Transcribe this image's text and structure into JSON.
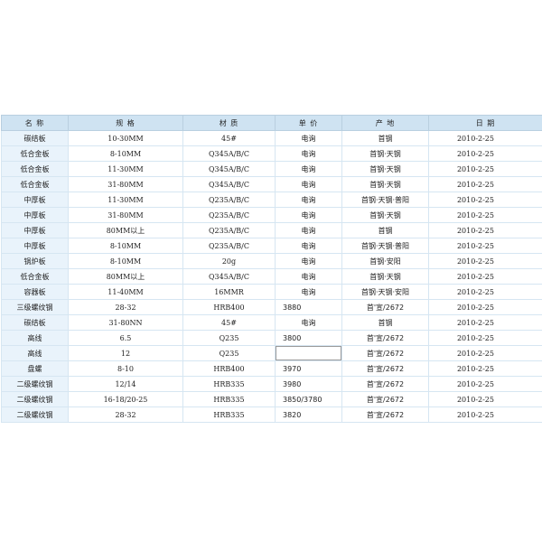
{
  "table": {
    "headers": [
      "名 称",
      "规 格",
      "材 质",
      "单 价",
      "产 地",
      "日 期"
    ],
    "rows": [
      {
        "name": "碳结板",
        "spec": "10-30MM",
        "material": "45#",
        "price": "电询",
        "origin": "首钢",
        "date": "2010-2-25"
      },
      {
        "name": "低合金板",
        "spec": "8-10MM",
        "material": "Q345A/B/C",
        "price": "电询",
        "origin": "首钢·天钢",
        "date": "2010-2-25"
      },
      {
        "name": "低合金板",
        "spec": "11-30MM",
        "material": "Q345A/B/C",
        "price": "电询",
        "origin": "首钢·天钢",
        "date": "2010-2-25"
      },
      {
        "name": "低合金板",
        "spec": "31-80MM",
        "material": "Q345A/B/C",
        "price": "电询",
        "origin": "首钢·天钢",
        "date": "2010-2-25"
      },
      {
        "name": "中厚板",
        "spec": "11-30MM",
        "material": "Q235A/B/C",
        "price": "电询",
        "origin": "首钢·天钢·普阳",
        "date": "2010-2-25"
      },
      {
        "name": "中厚板",
        "spec": "31-80MM",
        "material": "Q235A/B/C",
        "price": "电询",
        "origin": "首钢·天钢",
        "date": "2010-2-25"
      },
      {
        "name": "中厚板",
        "spec": "80MM以上",
        "material": "Q235A/B/C",
        "price": "电询",
        "origin": "首钢",
        "date": "2010-2-25"
      },
      {
        "name": "中厚板",
        "spec": "8-10MM",
        "material": "Q235A/B/C",
        "price": "电询",
        "origin": "首钢·天钢·普阳",
        "date": "2010-2-25"
      },
      {
        "name": "锅炉板",
        "spec": "8-10MM",
        "material": "20g",
        "price": "电询",
        "origin": "首钢·安阳",
        "date": "2010-2-25"
      },
      {
        "name": "低合金板",
        "spec": "80MM以上",
        "material": "Q345A/B/C",
        "price": "电询",
        "origin": "首钢·天钢",
        "date": "2010-2-25"
      },
      {
        "name": "容器板",
        "spec": "11-40MM",
        "material": "16MMR",
        "price": "电询",
        "origin": "首钢·天钢·安阳",
        "date": "2010-2-25"
      },
      {
        "name": "三级螺纹钢",
        "spec": "28-32",
        "material": "HRB400",
        "price": "3880",
        "origin": "首'宣/2672",
        "date": "2010-2-25"
      },
      {
        "name": "碳结板",
        "spec": "31-80NN",
        "material": "45#",
        "price": "电询",
        "origin": "首钢",
        "date": "2010-2-25"
      },
      {
        "name": "高线",
        "spec": "6.5",
        "material": "Q235",
        "price": "3800",
        "origin": "首'宣/2672",
        "date": "2010-2-25"
      },
      {
        "name": "高线",
        "spec": "12",
        "material": "Q235",
        "price": "",
        "origin": "首'宣/2672",
        "date": "2010-2-25"
      },
      {
        "name": "盘螺",
        "spec": "8-10",
        "material": "HRB400",
        "price": "3970",
        "origin": "首'宣/2672",
        "date": "2010-2-25"
      },
      {
        "name": "二级螺纹钢",
        "spec": "12/14",
        "material": "HRB335",
        "price": "3980",
        "origin": "首'宣/2672",
        "date": "2010-2-25"
      },
      {
        "name": "二级螺纹钢",
        "spec": "16-18/20-25",
        "material": "HRB335",
        "price": "3850/3780",
        "origin": "首'宣/2672",
        "date": "2010-2-25"
      },
      {
        "name": "二级螺纹钢",
        "spec": "28-32",
        "material": "HRB335",
        "price": "3820",
        "origin": "首'宣/2672",
        "date": "2010-2-25"
      }
    ]
  }
}
